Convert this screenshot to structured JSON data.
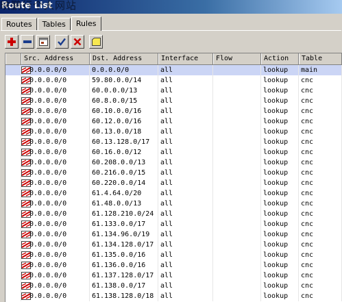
{
  "window": {
    "title": "Route List",
    "watermark": "映鹏行个人网站"
  },
  "tabs": [
    {
      "label": "Routes",
      "active": false
    },
    {
      "label": "Tables",
      "active": false
    },
    {
      "label": "Rules",
      "active": true
    }
  ],
  "toolbar": {
    "buttons": [
      {
        "icon": "plus-icon",
        "color": "#cc0000"
      },
      {
        "icon": "minus-icon",
        "color": "#1a3c8c"
      },
      {
        "icon": "window-icon",
        "color": "#808080"
      },
      {
        "icon": "check-icon",
        "color": "#1a3c8c"
      },
      {
        "icon": "x-icon",
        "color": "#cc0000"
      },
      {
        "icon": "note-icon",
        "color": "#e8c800"
      }
    ]
  },
  "columns": [
    "Src. Address",
    "Dst. Address",
    "Interface",
    "Flow",
    "Action",
    "Table"
  ],
  "rows": [
    {
      "src": "0.0.0.0/0",
      "dst": "0.0.0.0/0",
      "iface": "all",
      "flow": "",
      "action": "lookup",
      "table": "main",
      "selected": true
    },
    {
      "src": "0.0.0.0/0",
      "dst": "59.80.0.0/14",
      "iface": "all",
      "flow": "",
      "action": "lookup",
      "table": "cnc"
    },
    {
      "src": "0.0.0.0/0",
      "dst": "60.0.0.0/13",
      "iface": "all",
      "flow": "",
      "action": "lookup",
      "table": "cnc"
    },
    {
      "src": "0.0.0.0/0",
      "dst": "60.8.0.0/15",
      "iface": "all",
      "flow": "",
      "action": "lookup",
      "table": "cnc"
    },
    {
      "src": "0.0.0.0/0",
      "dst": "60.10.0.0/16",
      "iface": "all",
      "flow": "",
      "action": "lookup",
      "table": "cnc"
    },
    {
      "src": "0.0.0.0/0",
      "dst": "60.12.0.0/16",
      "iface": "all",
      "flow": "",
      "action": "lookup",
      "table": "cnc"
    },
    {
      "src": "0.0.0.0/0",
      "dst": "60.13.0.0/18",
      "iface": "all",
      "flow": "",
      "action": "lookup",
      "table": "cnc"
    },
    {
      "src": "0.0.0.0/0",
      "dst": "60.13.128.0/17",
      "iface": "all",
      "flow": "",
      "action": "lookup",
      "table": "cnc"
    },
    {
      "src": "0.0.0.0/0",
      "dst": "60.16.0.0/12",
      "iface": "all",
      "flow": "",
      "action": "lookup",
      "table": "cnc"
    },
    {
      "src": "0.0.0.0/0",
      "dst": "60.208.0.0/13",
      "iface": "all",
      "flow": "",
      "action": "lookup",
      "table": "cnc"
    },
    {
      "src": "0.0.0.0/0",
      "dst": "60.216.0.0/15",
      "iface": "all",
      "flow": "",
      "action": "lookup",
      "table": "cnc"
    },
    {
      "src": "0.0.0.0/0",
      "dst": "60.220.0.0/14",
      "iface": "all",
      "flow": "",
      "action": "lookup",
      "table": "cnc"
    },
    {
      "src": "0.0.0.0/0",
      "dst": "61.4.64.0/20",
      "iface": "all",
      "flow": "",
      "action": "lookup",
      "table": "cnc"
    },
    {
      "src": "0.0.0.0/0",
      "dst": "61.48.0.0/13",
      "iface": "all",
      "flow": "",
      "action": "lookup",
      "table": "cnc"
    },
    {
      "src": "0.0.0.0/0",
      "dst": "61.128.210.0/24",
      "iface": "all",
      "flow": "",
      "action": "lookup",
      "table": "cnc"
    },
    {
      "src": "0.0.0.0/0",
      "dst": "61.133.0.0/17",
      "iface": "all",
      "flow": "",
      "action": "lookup",
      "table": "cnc"
    },
    {
      "src": "0.0.0.0/0",
      "dst": "61.134.96.0/19",
      "iface": "all",
      "flow": "",
      "action": "lookup",
      "table": "cnc"
    },
    {
      "src": "0.0.0.0/0",
      "dst": "61.134.128.0/17",
      "iface": "all",
      "flow": "",
      "action": "lookup",
      "table": "cnc"
    },
    {
      "src": "0.0.0.0/0",
      "dst": "61.135.0.0/16",
      "iface": "all",
      "flow": "",
      "action": "lookup",
      "table": "cnc"
    },
    {
      "src": "0.0.0.0/0",
      "dst": "61.136.0.0/16",
      "iface": "all",
      "flow": "",
      "action": "lookup",
      "table": "cnc"
    },
    {
      "src": "0.0.0.0/0",
      "dst": "61.137.128.0/17",
      "iface": "all",
      "flow": "",
      "action": "lookup",
      "table": "cnc"
    },
    {
      "src": "0.0.0.0/0",
      "dst": "61.138.0.0/17",
      "iface": "all",
      "flow": "",
      "action": "lookup",
      "table": "cnc"
    },
    {
      "src": "0.0.0.0/0",
      "dst": "61.138.128.0/18",
      "iface": "all",
      "flow": "",
      "action": "lookup",
      "table": "cnc"
    }
  ]
}
